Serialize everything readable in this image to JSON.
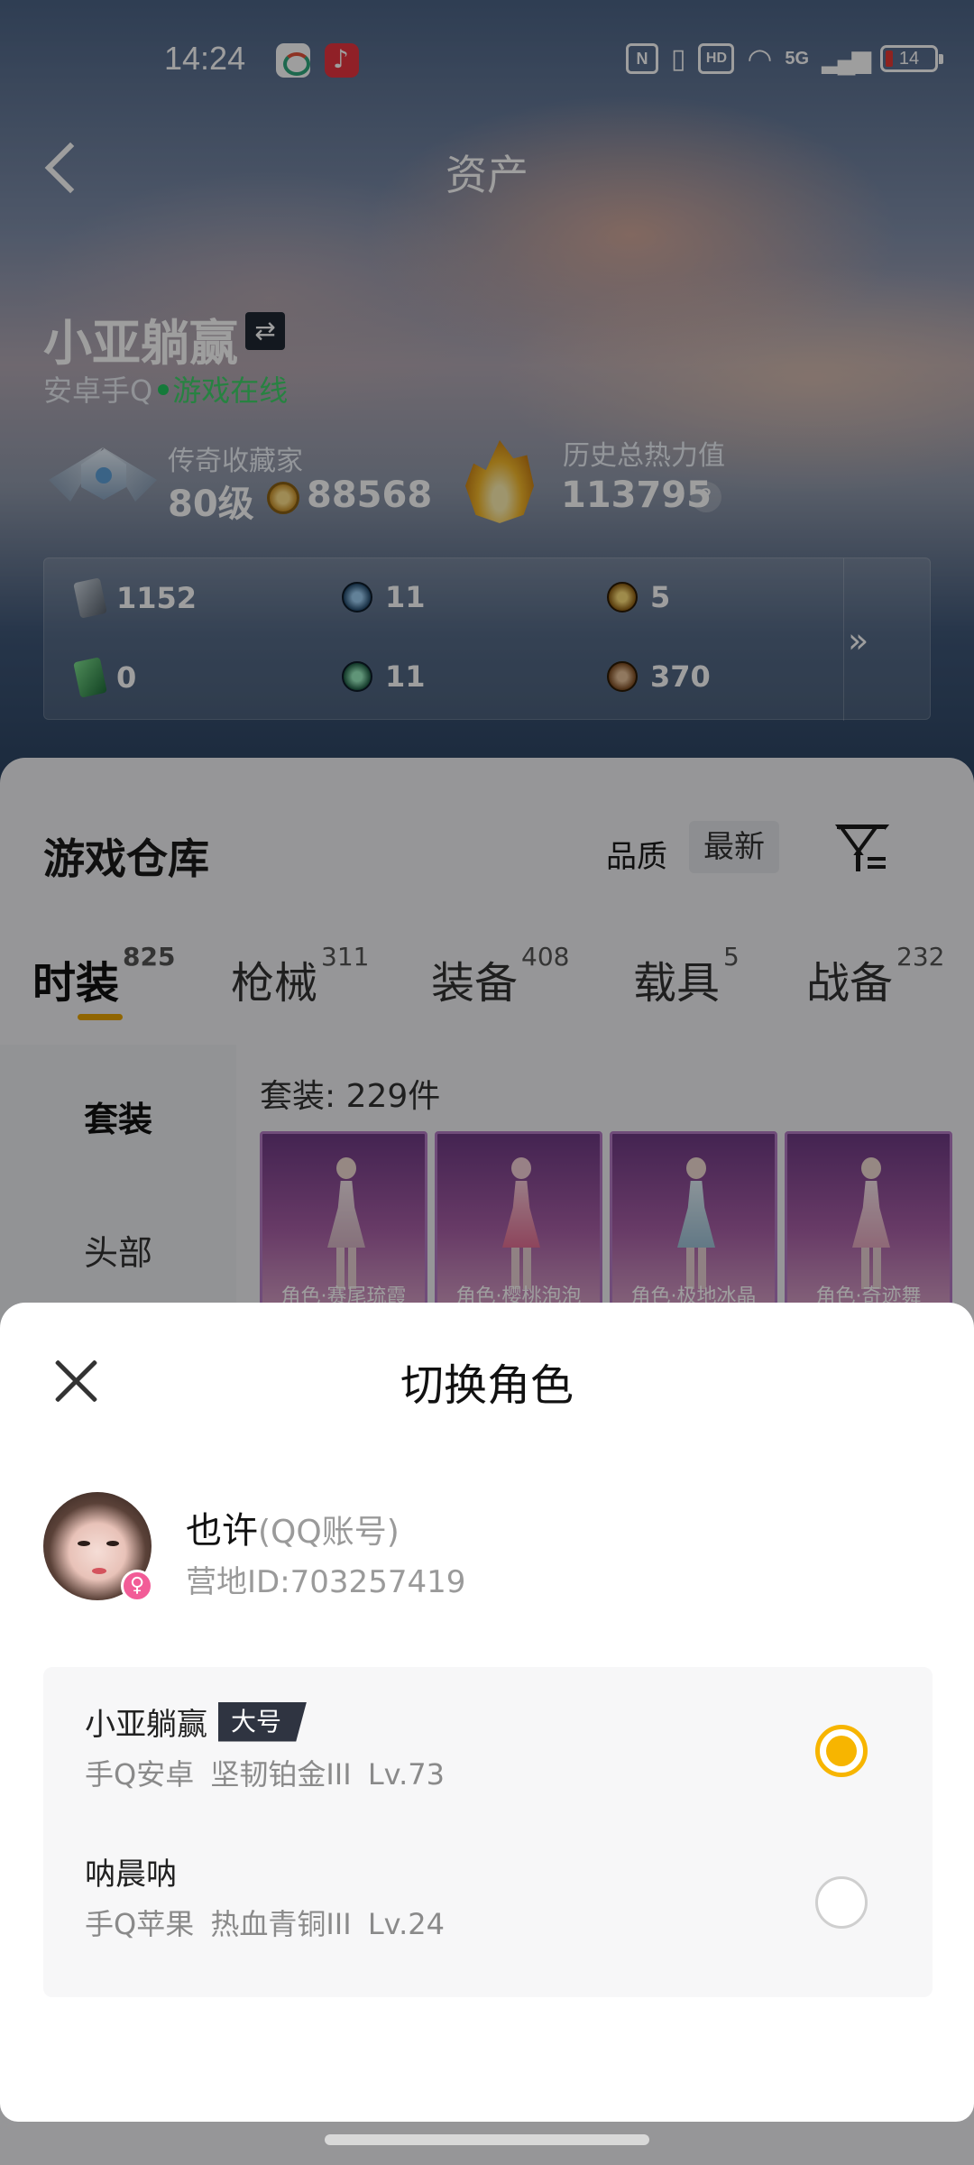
{
  "status_bar": {
    "time": "14:24",
    "signal_label": "5G",
    "hd_label": "HD",
    "battery": "14"
  },
  "header": {
    "title": "资产"
  },
  "profile": {
    "name": "小亚躺赢",
    "platform": "安卓手Q",
    "online_status": "游戏在线",
    "collector_title": "传奇收藏家",
    "collector_level": "80级",
    "coins": "88568",
    "heat_title": "历史总热力值",
    "heat_value": "113795",
    "help": "?"
  },
  "stats": [
    {
      "icon": "card-icon",
      "value": "1152"
    },
    {
      "icon": "blue-medal-icon",
      "value": "11"
    },
    {
      "icon": "gold-medal-icon",
      "value": "5"
    },
    {
      "icon": "green-card-icon",
      "value": "0"
    },
    {
      "icon": "green-medal-icon",
      "value": "11"
    },
    {
      "icon": "bronze-medal-icon",
      "value": "370"
    }
  ],
  "more_label": "»",
  "warehouse": {
    "title": "游戏仓库",
    "sort_quality": "品质",
    "sort_latest": "最新",
    "tabs": [
      {
        "label": "时装",
        "count": "825"
      },
      {
        "label": "枪械",
        "count": "311"
      },
      {
        "label": "装备",
        "count": "408"
      },
      {
        "label": "载具",
        "count": "5"
      },
      {
        "label": "战备",
        "count": "232"
      }
    ],
    "sidebar": [
      "套装",
      "头部"
    ],
    "suit_count": "套装: 229件",
    "items": [
      "角色·赛尾琉霞",
      "角色·樱桃泡泡",
      "角色·极地冰晶",
      "角色·奇迹舞"
    ]
  },
  "sheet": {
    "title": "切换角色",
    "account_name": "也许",
    "account_type": "(QQ账号)",
    "camp_id": "营地ID:703257419",
    "gender_symbol": "♀",
    "roles": [
      {
        "name": "小亚躺赢",
        "tag": "大号",
        "detail": "手Q安卓  坚韧铂金III  Lv.73",
        "selected": true
      },
      {
        "name": "呐晨呐",
        "tag": "",
        "detail": "手Q苹果  热血青铜III  Lv.24",
        "selected": false
      }
    ]
  },
  "colors": {
    "accent": "#f7b500",
    "online": "#3fd26a",
    "tag_bg": "#2f3441",
    "gender_badge": "#f25c97"
  }
}
